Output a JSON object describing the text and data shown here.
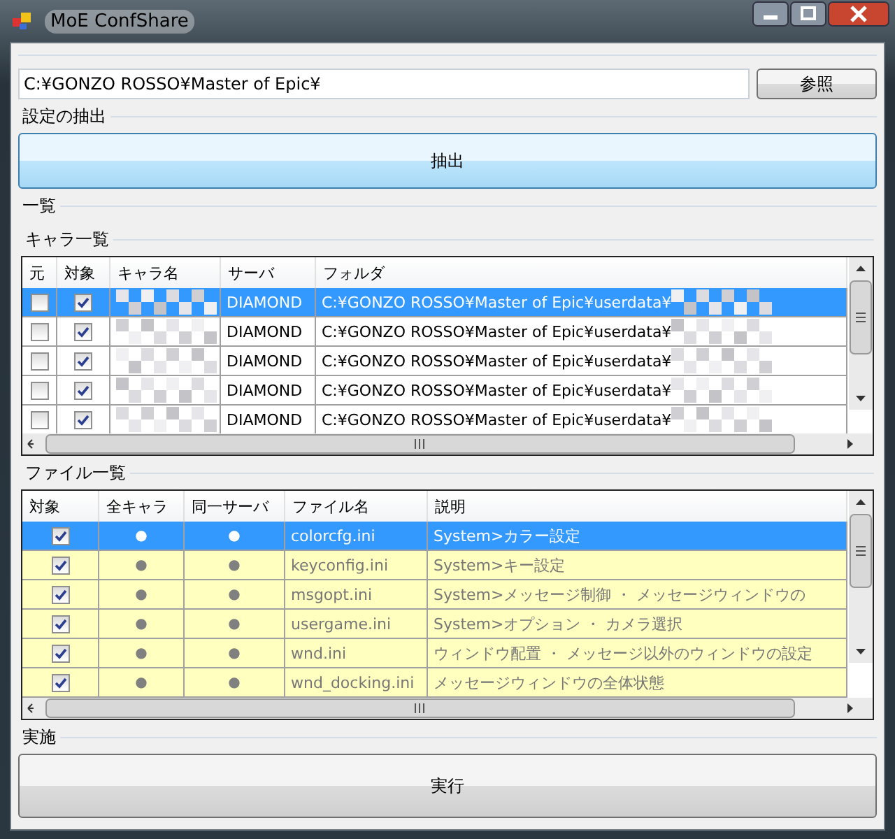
{
  "window": {
    "title": "MoE ConfShare"
  },
  "path_field": {
    "value": "C:¥GONZO ROSSO¥Master of Epic¥"
  },
  "browse_button": "参照",
  "extract_section": {
    "label": "設定の抽出",
    "button": "抽出"
  },
  "list_section": {
    "label": "一覧"
  },
  "characters": {
    "label": "キャラ一覧",
    "columns": [
      "元",
      "対象",
      "キャラ名",
      "サーバ",
      "フォルダ"
    ],
    "rows": [
      {
        "source_checked": false,
        "target_checked": true,
        "server": "DIAMOND",
        "folder": "C:¥GONZO ROSSO¥Master of Epic¥userdata¥",
        "selected": true
      },
      {
        "source_checked": false,
        "target_checked": true,
        "server": "DIAMOND",
        "folder": "C:¥GONZO ROSSO¥Master of Epic¥userdata¥",
        "selected": false
      },
      {
        "source_checked": false,
        "target_checked": true,
        "server": "DIAMOND",
        "folder": "C:¥GONZO ROSSO¥Master of Epic¥userdata¥",
        "selected": false
      },
      {
        "source_checked": false,
        "target_checked": true,
        "server": "DIAMOND",
        "folder": "C:¥GONZO ROSSO¥Master of Epic¥userdata¥",
        "selected": false
      },
      {
        "source_checked": false,
        "target_checked": true,
        "server": "DIAMOND",
        "folder": "C:¥GONZO ROSSO¥Master of Epic¥userdata¥",
        "selected": false
      }
    ]
  },
  "files": {
    "label": "ファイル一覧",
    "columns": [
      "対象",
      "全キャラ",
      "同一サーバ",
      "ファイル名",
      "説明"
    ],
    "rows": [
      {
        "checked": true,
        "all_characters": "●",
        "same_server": "●",
        "file": "colorcfg.ini",
        "description": "System>カラー設定",
        "selected": true
      },
      {
        "checked": true,
        "all_characters": "●",
        "same_server": "●",
        "file": "keyconfig.ini",
        "description": "System>キー設定",
        "selected": false
      },
      {
        "checked": true,
        "all_characters": "●",
        "same_server": "●",
        "file": "msgopt.ini",
        "description": "System>メッセージ制御 ・ メッセージウィンドウの",
        "selected": false
      },
      {
        "checked": true,
        "all_characters": "●",
        "same_server": "●",
        "file": "usergame.ini",
        "description": "System>オプション ・ カメラ選択",
        "selected": false
      },
      {
        "checked": true,
        "all_characters": "●",
        "same_server": "●",
        "file": "wnd.ini",
        "description": "ウィンドウ配置 ・ メッセージ以外のウィンドウの設定",
        "selected": false
      },
      {
        "checked": true,
        "all_characters": "●",
        "same_server": "●",
        "file": "wnd_docking.ini",
        "description": "メッセージウィンドウの全体状態",
        "selected": false
      }
    ]
  },
  "run_section": {
    "label": "実施",
    "button": "実行"
  }
}
